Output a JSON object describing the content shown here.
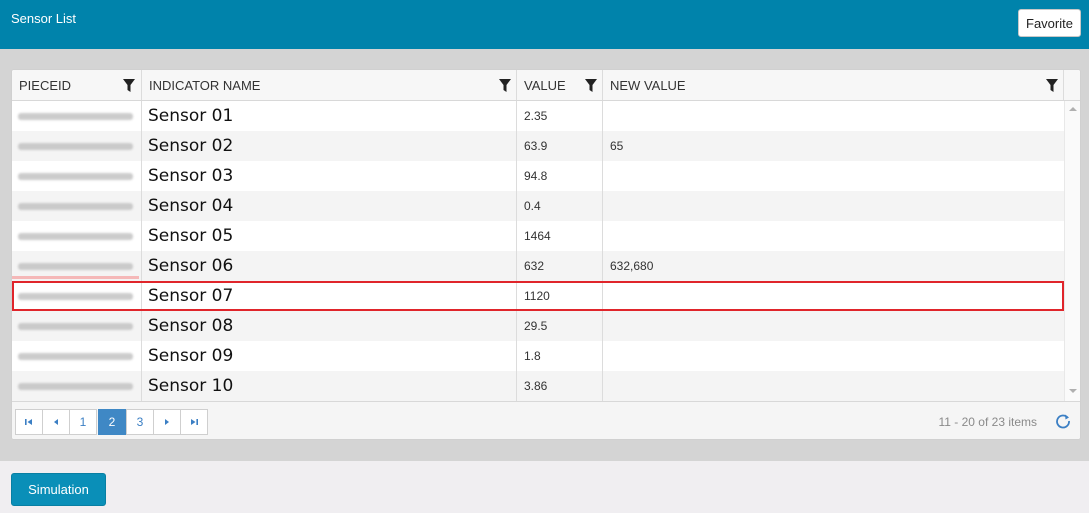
{
  "header": {
    "title": "Sensor List",
    "favorite_label": "Favorite"
  },
  "grid": {
    "columns": [
      "PIECEID",
      "INDICATOR NAME",
      "VALUE",
      "NEW VALUE"
    ],
    "rows": [
      {
        "indicator_name": "Sensor 01",
        "value": "2.35",
        "new_value": ""
      },
      {
        "indicator_name": "Sensor 02",
        "value": "63.9",
        "new_value": "65"
      },
      {
        "indicator_name": "Sensor 03",
        "value": "94.8",
        "new_value": ""
      },
      {
        "indicator_name": "Sensor 04",
        "value": "0.4",
        "new_value": ""
      },
      {
        "indicator_name": "Sensor 05",
        "value": "1464",
        "new_value": ""
      },
      {
        "indicator_name": "Sensor 06",
        "value": "632",
        "new_value": "632,680"
      },
      {
        "indicator_name": "Sensor 07",
        "value": "1120",
        "new_value": ""
      },
      {
        "indicator_name": "Sensor 08",
        "value": "29.5",
        "new_value": ""
      },
      {
        "indicator_name": "Sensor 09",
        "value": "1.8",
        "new_value": ""
      },
      {
        "indicator_name": "Sensor 10",
        "value": "3.86",
        "new_value": ""
      }
    ]
  },
  "pager": {
    "pages": [
      "1",
      "2",
      "3"
    ],
    "current_page": "2",
    "info": "11 - 20 of 23 items",
    "first_icon": "first-page-icon",
    "prev_icon": "prev-page-icon",
    "next_icon": "next-page-icon",
    "last_icon": "last-page-icon",
    "refresh_icon": "refresh-icon"
  },
  "footer": {
    "simulation_label": "Simulation"
  },
  "colors": {
    "header_bg": "#0083ab",
    "accent": "#3f88c5",
    "highlight": "#e0252b",
    "button": "#0a8fb8"
  }
}
